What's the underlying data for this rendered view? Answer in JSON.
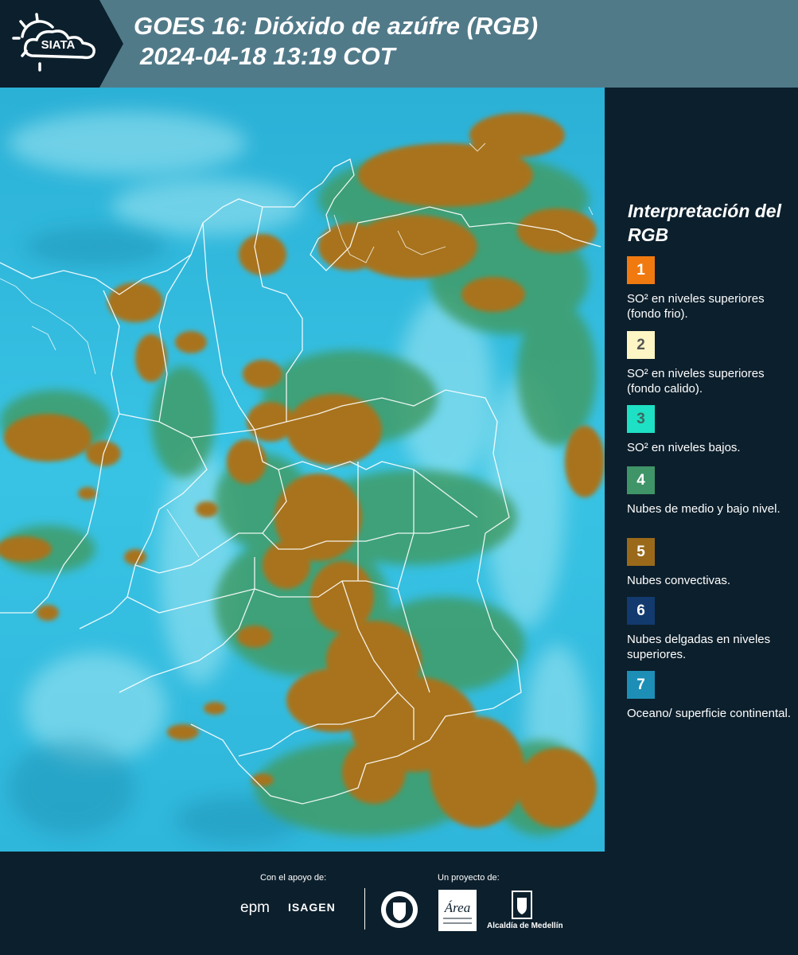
{
  "header": {
    "logo_text": "SIATA",
    "title_line1": "GOES 16: Dióxido de azúfre (RGB)",
    "title_line2": "2024-04-18 13:19 COT"
  },
  "legend": {
    "title": "Interpretación del RGB",
    "items": [
      {
        "number": "1",
        "text": "SO² en niveles superiores (fondo frio).",
        "color": "#f07a10",
        "num_color": "#ffffff"
      },
      {
        "number": "2",
        "text": "SO² en niveles superiores (fondo calido).",
        "color": "#fdf5c4",
        "num_color": "#555555"
      },
      {
        "number": "3",
        "text": "SO² en niveles bajos.",
        "color": "#1ee0c4",
        "num_color": "#3a6a60"
      },
      {
        "number": "4",
        "text": "Nubes de medio y bajo nivel.",
        "color": "#3f9468",
        "num_color": "#ffffff"
      },
      {
        "number": "5",
        "text": "Nubes convectivas.",
        "color": "#9a6a1a",
        "num_color": "#ffffff"
      },
      {
        "number": "6",
        "text": "Nubes delgadas en niveles superiores.",
        "color": "#123a6e",
        "num_color": "#ffffff"
      },
      {
        "number": "7",
        "text": "Oceano/ superficie continental.",
        "color": "#1d8fb6",
        "num_color": "#ffffff"
      }
    ]
  },
  "footer": {
    "support_label": "Con el apoyo de:",
    "project_label": "Un proyecto de:",
    "sponsors": [
      "epm",
      "ISAGEN"
    ],
    "area_text": "Área",
    "alcaldia": "Alcaldía de Medellín"
  },
  "map_colors": {
    "base": "#2fb8dc",
    "convective": "#a8731e",
    "low_cloud": "#3e9c6a",
    "thin_cloud": "#9fe7f2"
  }
}
